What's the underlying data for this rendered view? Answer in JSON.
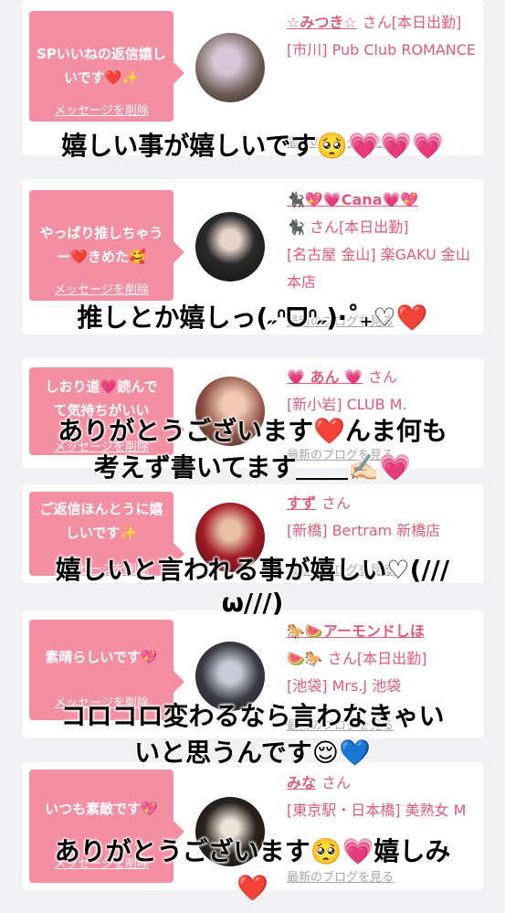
{
  "cards": [
    {
      "message": "SPいいねの返信嬉しいです❤️✨",
      "delete": "メッセージを削除",
      "name": "☆みつき☆",
      "san": "さん[本日出勤]",
      "store": "[市川] Pub Club ROMANCE",
      "blog": "最新のブログを見る",
      "avatar_color": "#6b5a52"
    },
    {
      "message": "やっぱり推しちゃうー❤️きめた🥰",
      "delete": "メッセージを削除",
      "name": "🐈‍⬛💖💗Cana💗💖",
      "san": "🐈‍⬛ さん[本日出勤]",
      "store": "[名古屋 金山] 楽GAKU 金山本店",
      "blog": "最新のブログを見る",
      "avatar_color": "#1e1e1e"
    },
    {
      "message": "しおり道💗読んで て気持ちがいい",
      "delete": "メッセージを削除",
      "name": "💗 あん 💗",
      "san": "さん",
      "store": "[新小岩] CLUB M.",
      "blog": "最新のブログを見る",
      "avatar_color": "#8b4e42"
    },
    {
      "message": "ご返信ほんとうに嬉しいです✨",
      "delete": "メッセージを削除",
      "name": "すず",
      "san": "さん",
      "store": "[新橋] Bertram 新橋店",
      "blog": "最新のブログを見る",
      "avatar_color": "#a21c27"
    },
    {
      "message": "素晴らしいです💖",
      "delete": "メッセージを削除",
      "name": "🐎🍉アーモンドしほ",
      "san": "🍉🐎 さん[本日出勤]",
      "store": "[池袋] Mrs.J 池袋",
      "blog": "最新のブログを見る",
      "avatar_color": "#3b3b44"
    },
    {
      "message": "いつも素敵です💖",
      "delete": "メッセージを削除",
      "name": "みな",
      "san": "さん",
      "store": "[東京駅・日本橋] 美熟女 M",
      "blog": "最新のブログを見る",
      "avatar_color": "#2a2420"
    }
  ],
  "overlays": [
    "嬉しい事が嬉しいです🥺💗💗💗",
    "推しとか嬉しっ(˶ᐢᗜᐢ˶)‧˚₊♡❤️",
    "ありがとうございます❤️んま何も",
    "考えず書いてます＿＿✍🏻💗",
    "嬉しいと言われる事が嬉しい♡(///",
    "ω///)",
    "コロコロ変わるなら言わなきゃい",
    "いと思うんです😌💙",
    "ありがとうございます🥺💗嬉しみ",
    "❤️"
  ]
}
